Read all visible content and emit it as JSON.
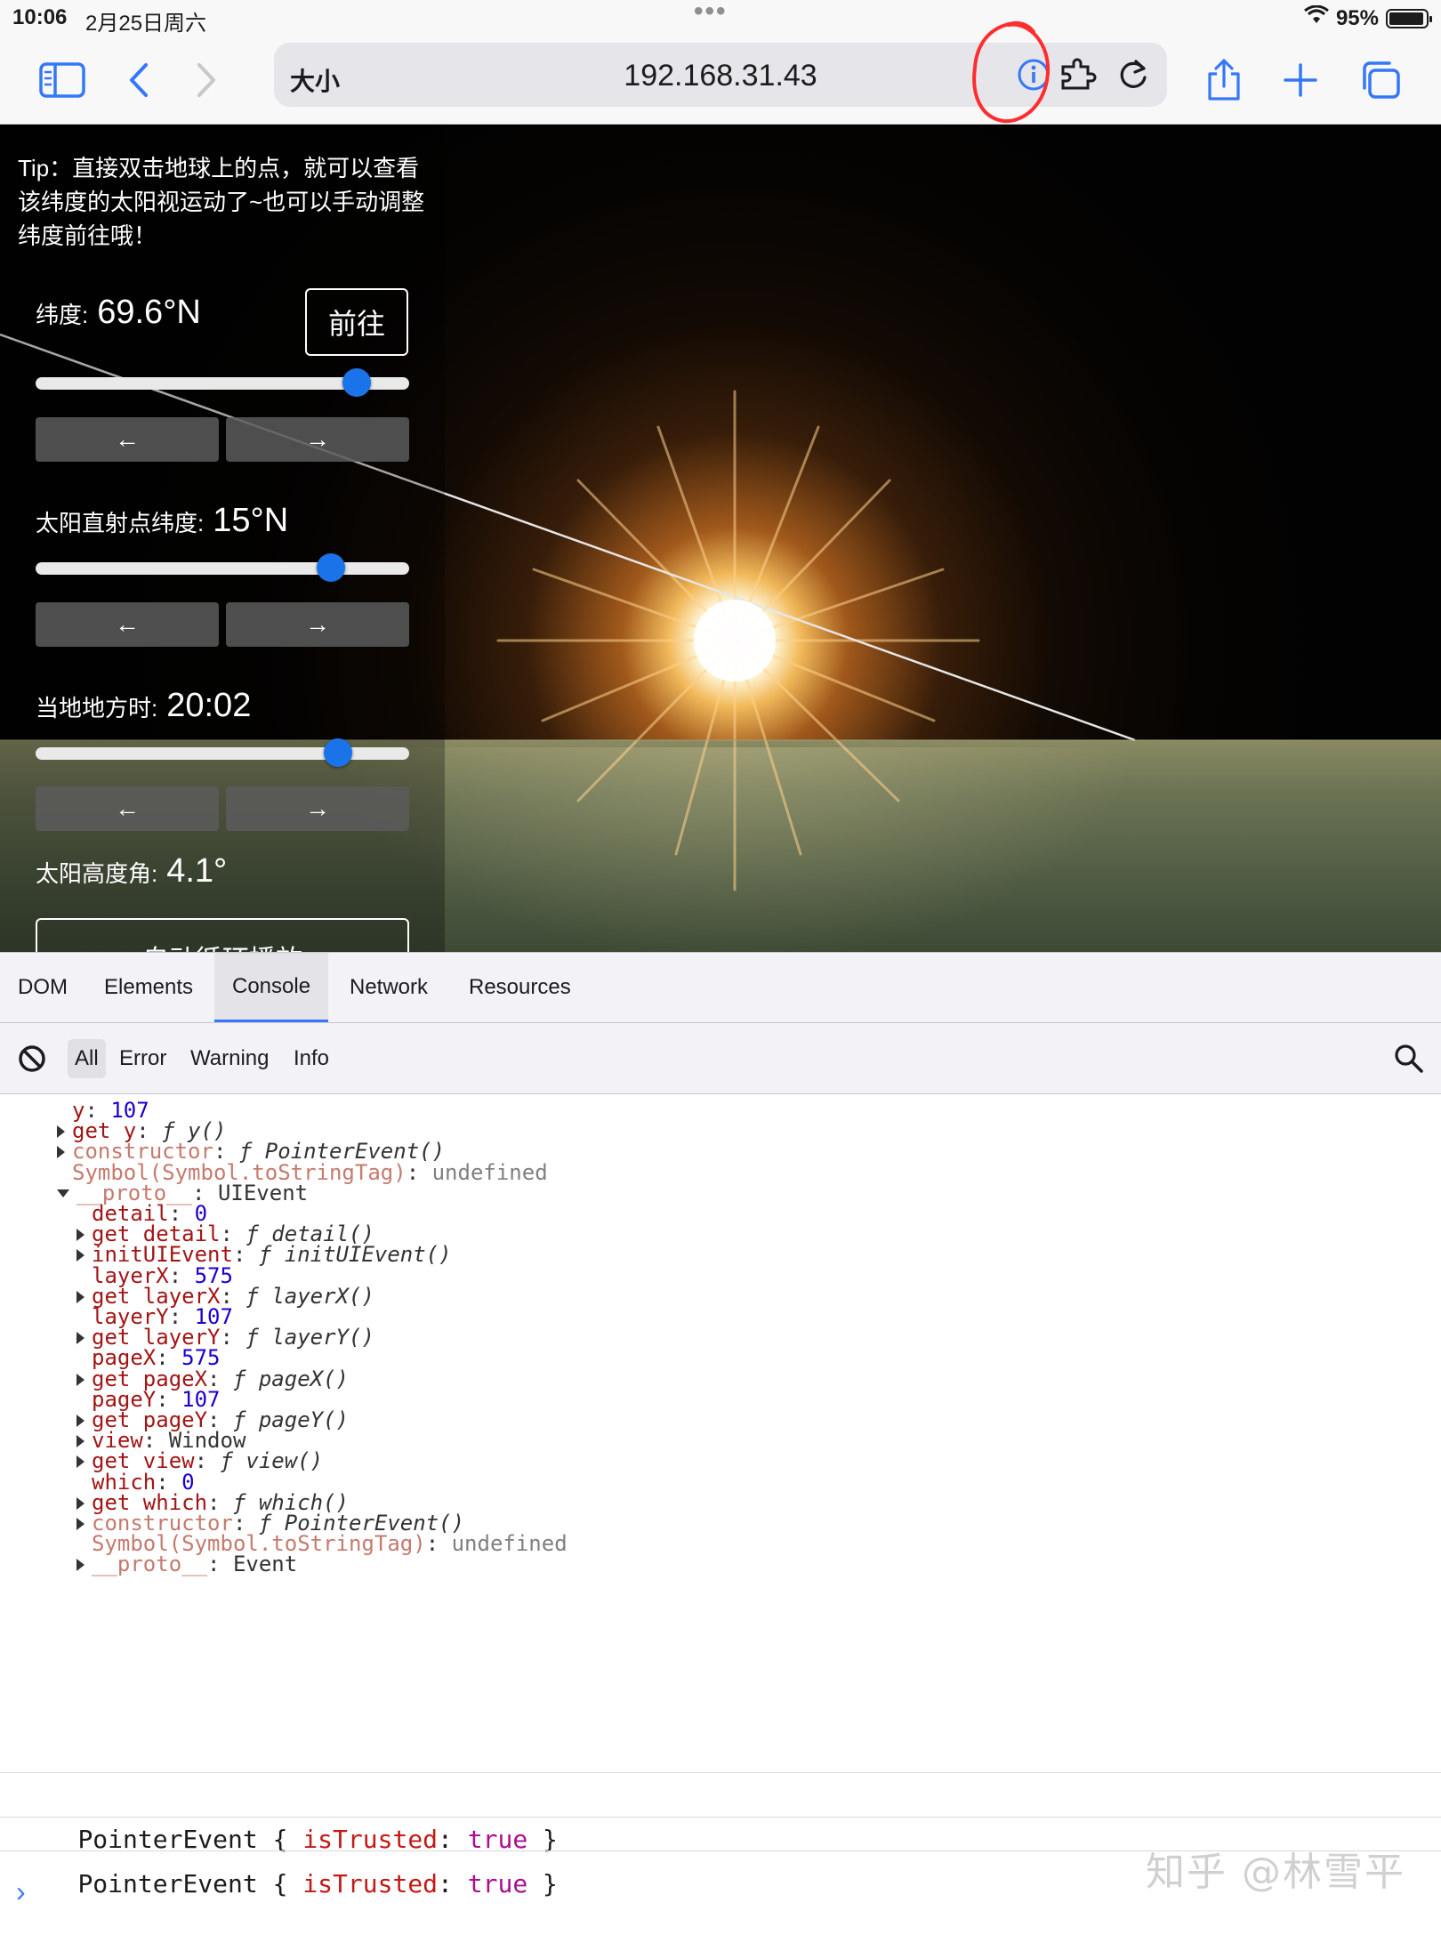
{
  "status": {
    "time": "10:06",
    "date": "2月25日周六",
    "battery": "95%",
    "battery_level": 0.95
  },
  "toolbar": {
    "size_label": "大小",
    "url": "192.168.31.43"
  },
  "icons": {
    "sidebar": "sidebar-icon",
    "back": "chevron-left-icon",
    "forward": "chevron-right-icon",
    "info": "info-icon",
    "extension": "puzzle-icon",
    "reload": "reload-icon",
    "share": "share-icon",
    "new_tab": "plus-icon",
    "tabs": "tabs-icon"
  },
  "page": {
    "tip": "Tip：直接双击地球上的点，就可以查看该纬度的太阳视运动了~也可以手动调整纬度前往哦！",
    "latitude": {
      "label": "纬度:",
      "value": "69.6°N",
      "level": 0.86
    },
    "goto_label": "前往",
    "sun_lat": {
      "label": "太阳直射点纬度:",
      "value": "15°N",
      "level": 0.79
    },
    "local_time": {
      "label": "当地地方时:",
      "value": "20:02",
      "level": 0.81
    },
    "altitude": {
      "label": "太阳高度角:",
      "value": "4.1°"
    },
    "prev_label": "←",
    "next_label": "→",
    "autoplay_label": "自动循环播放"
  },
  "devtools": {
    "tabs": [
      "DOM",
      "Elements",
      "Console",
      "Network",
      "Resources"
    ],
    "active_tab": "Console",
    "filters": [
      "All",
      "Error",
      "Warning",
      "Info"
    ],
    "active_filter": "All"
  },
  "console": {
    "tree": [
      {
        "key": "y",
        "val": "107",
        "type": "num"
      },
      {
        "key": "get y",
        "val": "ƒ y()",
        "type": "fn",
        "arrow": "right"
      },
      {
        "key": "constructor",
        "val": "ƒ PointerEvent()",
        "type": "fn",
        "arrow": "right",
        "dimkey": true
      },
      {
        "key": "Symbol(Symbol.toStringTag)",
        "val": "undefined",
        "type": "dim",
        "dimkey": true
      },
      {
        "key": "__proto__",
        "val": "UIEvent",
        "type": "plain",
        "arrow": "down",
        "dimkey": true
      },
      {
        "key": "detail",
        "val": "0",
        "type": "num"
      },
      {
        "key": "get detail",
        "val": "ƒ detail()",
        "type": "fn",
        "arrow": "right"
      },
      {
        "key": "initUIEvent",
        "val": "ƒ initUIEvent()",
        "type": "fn",
        "arrow": "right"
      },
      {
        "key": "layerX",
        "val": "575",
        "type": "num"
      },
      {
        "key": "get layerX",
        "val": "ƒ layerX()",
        "type": "fn",
        "arrow": "right"
      },
      {
        "key": "layerY",
        "val": "107",
        "type": "num"
      },
      {
        "key": "get layerY",
        "val": "ƒ layerY()",
        "type": "fn",
        "arrow": "right"
      },
      {
        "key": "pageX",
        "val": "575",
        "type": "num"
      },
      {
        "key": "get pageX",
        "val": "ƒ pageX()",
        "type": "fn",
        "arrow": "right"
      },
      {
        "key": "pageY",
        "val": "107",
        "type": "num"
      },
      {
        "key": "get pageY",
        "val": "ƒ pageY()",
        "type": "fn",
        "arrow": "right"
      },
      {
        "key": "view",
        "val": "Window",
        "type": "plain",
        "arrow": "right"
      },
      {
        "key": "get view",
        "val": "ƒ view()",
        "type": "fn",
        "arrow": "right"
      },
      {
        "key": "which",
        "val": "0",
        "type": "num"
      },
      {
        "key": "get which",
        "val": "ƒ which()",
        "type": "fn",
        "arrow": "right"
      },
      {
        "key": "constructor",
        "val": "ƒ PointerEvent()",
        "type": "fn",
        "arrow": "right",
        "dimkey": true
      },
      {
        "key": "Symbol(Symbol.toStringTag)",
        "val": "undefined",
        "type": "dim",
        "dimkey": true
      },
      {
        "key": "__proto__",
        "val": "Event",
        "type": "plain",
        "arrow": "right",
        "dimkey": true
      }
    ],
    "logs": [
      {
        "name": "PointerEvent",
        "key": "isTrusted",
        "val": "true"
      },
      {
        "name": "PointerEvent",
        "key": "isTrusted",
        "val": "true"
      }
    ],
    "prompt": "›"
  },
  "watermark": "知乎 @林雪平"
}
